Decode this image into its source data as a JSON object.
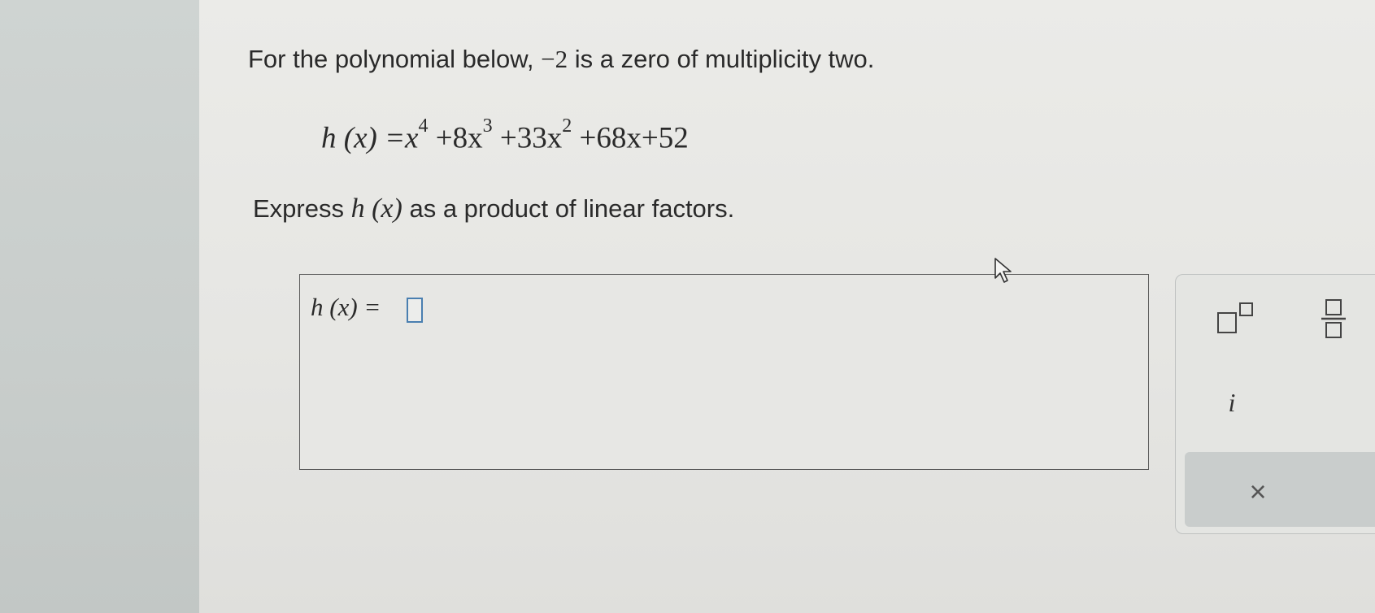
{
  "question": {
    "intro_before": "For the polynomial below, ",
    "zero_value": "−2",
    "intro_after": " is a zero of multiplicity two."
  },
  "equation": {
    "lhs": "h (x) =",
    "x": "x",
    "exp4": "4",
    "term2": " +8x",
    "exp3": "3",
    "term3": " +33x",
    "exp2": "2",
    "term4": " +68x+52"
  },
  "instruction": {
    "before": "Express ",
    "func": "h (x)",
    "after": " as a product of linear factors."
  },
  "answer": {
    "label": "h (x)  =",
    "slot_color": "#4a7fb0"
  },
  "toolbar": {
    "exponent_icon": "superscript-icon",
    "fraction_icon": "fraction-icon",
    "imaginary_label": "i",
    "clear_label": "×"
  }
}
